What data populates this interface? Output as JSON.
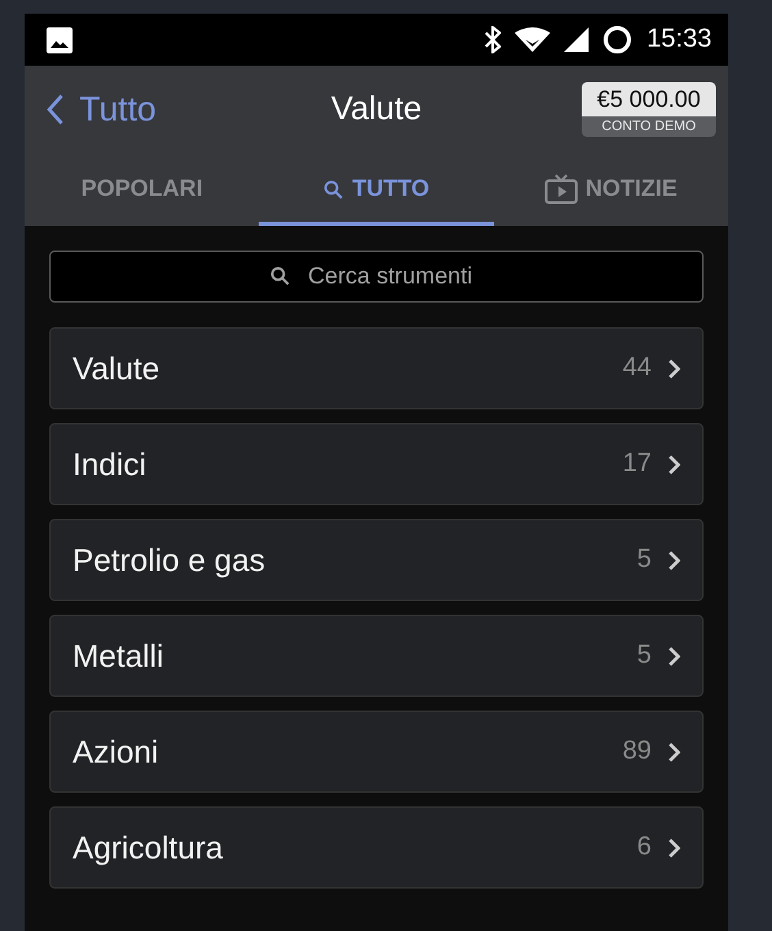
{
  "status_bar": {
    "time": "15:33"
  },
  "header": {
    "back_label": "Tutto",
    "title": "Valute",
    "balance": {
      "amount": "€5 000.00",
      "label": "CONTO DEMO"
    }
  },
  "tabs": [
    {
      "label": "POPOLARI",
      "kind": "plain",
      "selected": false
    },
    {
      "label": "TUTTO",
      "kind": "search",
      "selected": true
    },
    {
      "label": "NOTIZIE",
      "kind": "tv",
      "selected": false
    }
  ],
  "search": {
    "placeholder": "Cerca strumenti"
  },
  "categories": [
    {
      "name": "Valute",
      "count": "44"
    },
    {
      "name": "Indici",
      "count": "17"
    },
    {
      "name": "Petrolio e gas",
      "count": "5"
    },
    {
      "name": "Metalli",
      "count": "5"
    },
    {
      "name": "Azioni",
      "count": "89"
    },
    {
      "name": "Agricoltura",
      "count": "6"
    }
  ]
}
